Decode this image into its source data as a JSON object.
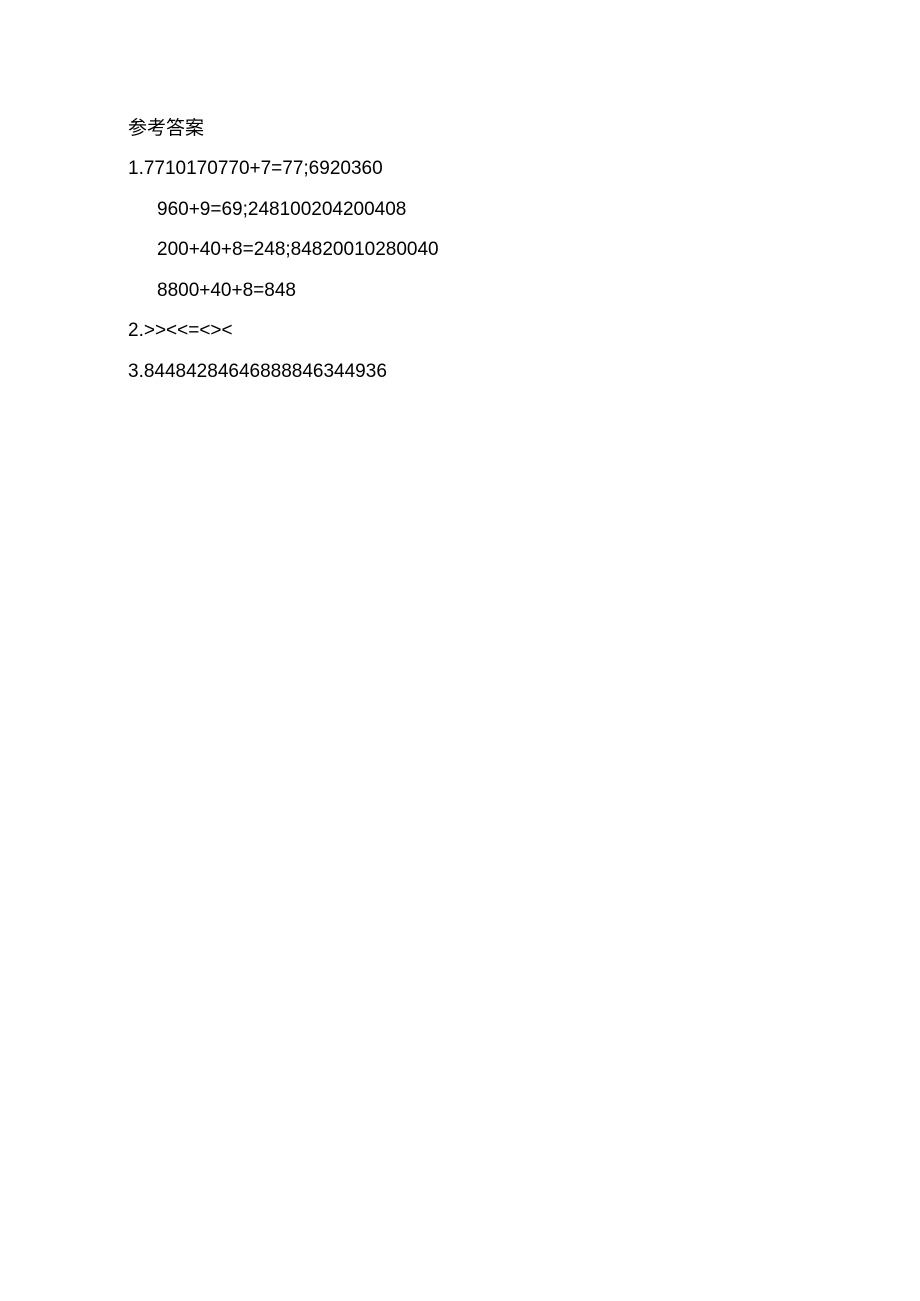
{
  "title": "参考答案",
  "answers": {
    "line1": "1.7710170770+7=77;6920360",
    "line2": "960+9=69;248100204200408",
    "line3": "200+40+8=248;84820010280040",
    "line4": "8800+40+8=848",
    "line5": "2.>><<=<><",
    "line6": "3.84484284646888846344936"
  }
}
